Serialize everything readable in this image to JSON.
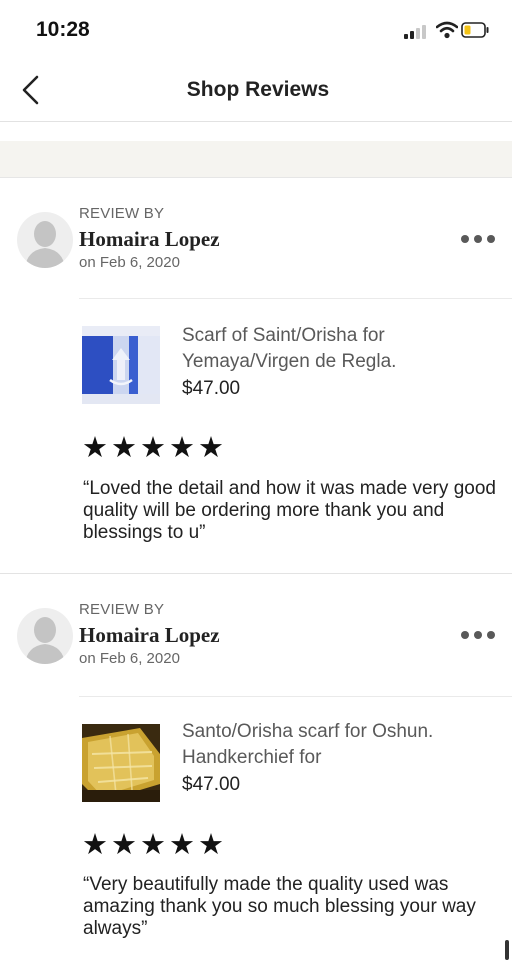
{
  "status_bar": {
    "time": "10:28"
  },
  "header": {
    "title": "Shop Reviews",
    "back_icon": "chevron-left-icon"
  },
  "reviews": [
    {
      "label": "REVIEW BY",
      "name": "Homaira Lopez",
      "date": "on Feb 6, 2020",
      "item_title": "Scarf of Saint/Orisha for Yemaya/Virgen de Regla.",
      "item_price": "$47.00",
      "rating": 5,
      "text": "“Loved the detail and how it was made very good quality will be ordering more thank you and blessings to u”"
    },
    {
      "label": "REVIEW BY",
      "name": "Homaira Lopez",
      "date": "on Feb 6, 2020",
      "item_title": "Santo/Orisha scarf for Oshun. Handkerchief for",
      "item_price": "$47.00",
      "rating": 5,
      "text": "“Very beautifully made the quality used was amazing thank you so much blessing your way always”"
    }
  ],
  "colors": {
    "accent_text": "#222222",
    "muted_text": "#666666",
    "band": "#f5f4f0",
    "battery": "#f3c316"
  }
}
